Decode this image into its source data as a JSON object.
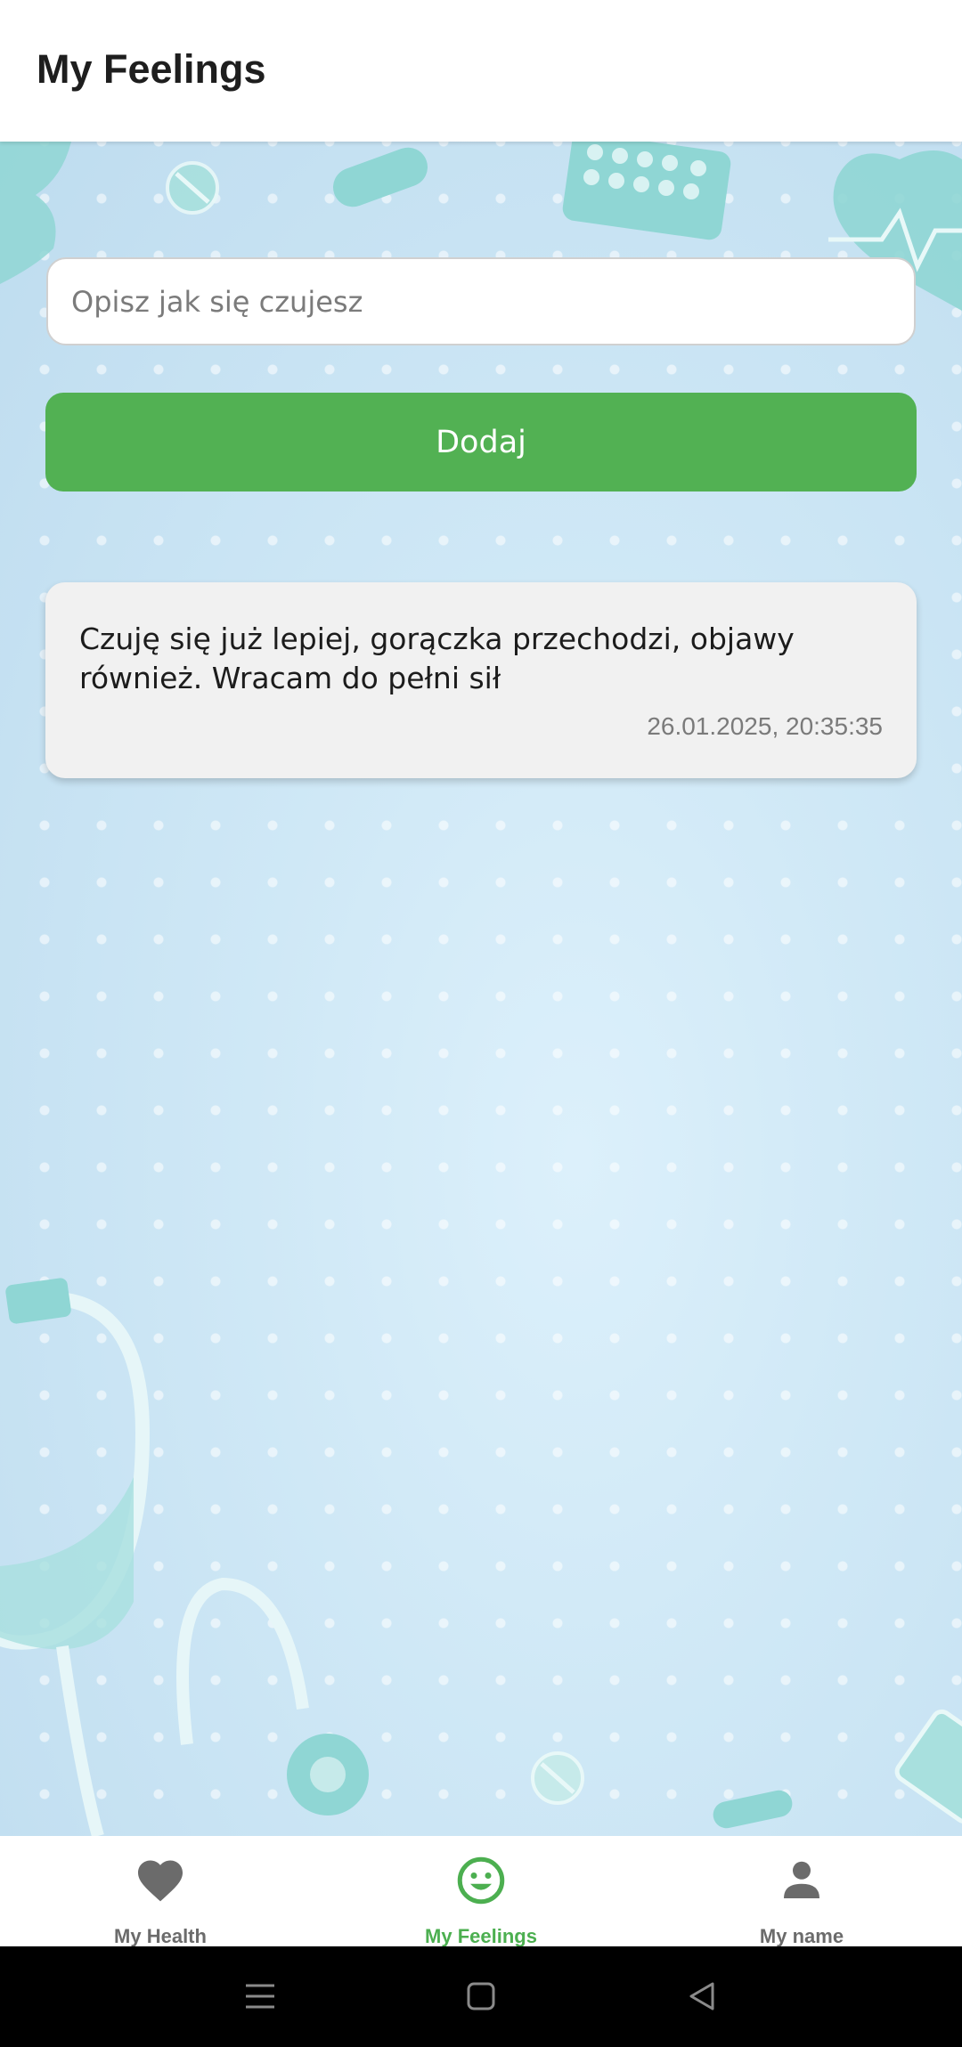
{
  "header": {
    "title": "My Feelings"
  },
  "form": {
    "placeholder": "Opisz jak się czujesz",
    "value": "",
    "add_label": "Dodaj"
  },
  "entries": [
    {
      "text": "Czuję się już lepiej, gorączka przechodzi, objawy również. Wracam do pełni sił",
      "date": "26.01.2025, 20:35:35"
    }
  ],
  "bottom_nav": {
    "items": [
      {
        "label": "My Health",
        "icon": "heart-icon",
        "active": false
      },
      {
        "label": "My Feelings",
        "icon": "smiley-icon",
        "active": true
      },
      {
        "label": "My name",
        "icon": "person-icon",
        "active": false
      }
    ]
  },
  "system_nav": {
    "buttons": [
      {
        "icon": "menu-icon"
      },
      {
        "icon": "home-icon"
      },
      {
        "icon": "back-icon"
      }
    ]
  },
  "colors": {
    "accent": "#52b153",
    "active_nav": "#4caf50",
    "inactive_nav": "#6b6b6b",
    "background": "#c6e2f2",
    "card": "#f1f1f1"
  }
}
